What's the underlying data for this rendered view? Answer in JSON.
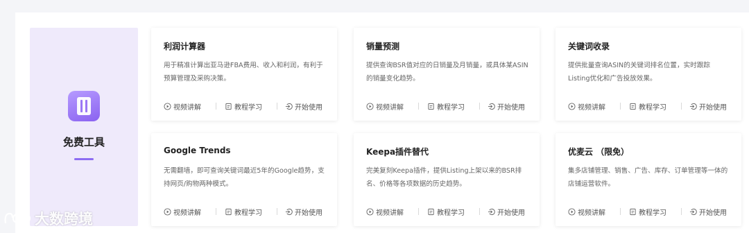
{
  "section": {
    "title": "免费工具",
    "icon": "tools-icon",
    "accent": "#8d6cf2"
  },
  "actions": {
    "video": "视频讲解",
    "tutorial": "教程学习",
    "start": "开始使用"
  },
  "tools": [
    {
      "title": "利润计算器",
      "desc": "用于精准计算出亚马逊FBA费用、收入和利润，有利于预算管理及采购决策。"
    },
    {
      "title": "销量预测",
      "desc": "提供查询BSR值对应的日销量及月销量，或具体某ASIN的销量变化趋势。"
    },
    {
      "title": "关键词收录",
      "desc": "提供批量查询ASIN的关键词排名位置，实时跟踪Listing优化和广告投放效果。"
    },
    {
      "title": "Google Trends",
      "desc": "无需翻墙，即可查询关键词最近5年的Google趋势，支持网页/购物两种模式。"
    },
    {
      "title": "Keepa插件替代",
      "desc": "完美复刻Keepa插件，提供Listing上架以来的BSR排名、价格等各项数据的历史趋势。"
    },
    {
      "title": "优麦云 （限免）",
      "desc": "集多店铺管理、销售、广告、库存、订单管理等一体的店铺运营软件。"
    }
  ],
  "watermark": "大数跨境"
}
